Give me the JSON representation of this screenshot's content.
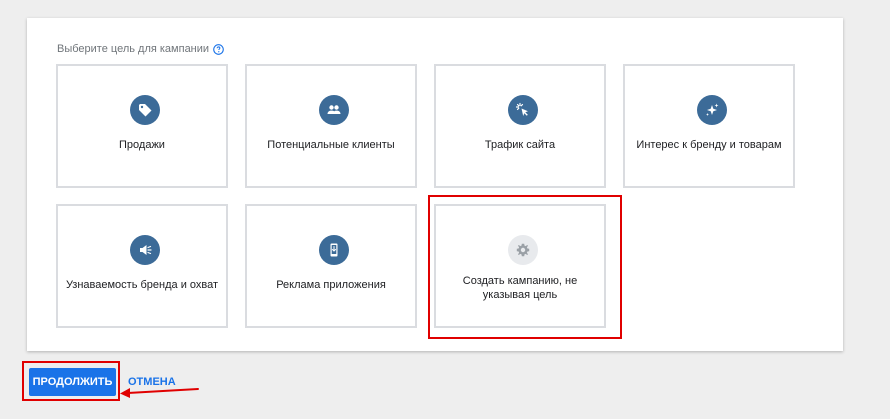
{
  "prompt": {
    "text": "Выберите цель для кампании"
  },
  "goals": [
    {
      "label": "Продажи",
      "icon": "tag-icon"
    },
    {
      "label": "Потенциальные клиенты",
      "icon": "people-icon"
    },
    {
      "label": "Трафик сайта",
      "icon": "cursor-click-icon"
    },
    {
      "label": "Интерес к бренду и товарам",
      "icon": "sparkle-icon"
    },
    {
      "label": "Узнаваемость бренда и охват",
      "icon": "megaphone-icon"
    },
    {
      "label": "Реклама приложения",
      "icon": "phone-download-icon"
    },
    {
      "label": "Создать кампанию, не указывая цель",
      "icon": "gear-icon"
    }
  ],
  "actions": {
    "continue_label": "ПРОДОЛЖИТЬ",
    "cancel_label": "ОТМЕНА"
  },
  "colors": {
    "accent": "#1a73e8",
    "icon_bg": "#3c6b98",
    "highlight": "#e00000"
  }
}
